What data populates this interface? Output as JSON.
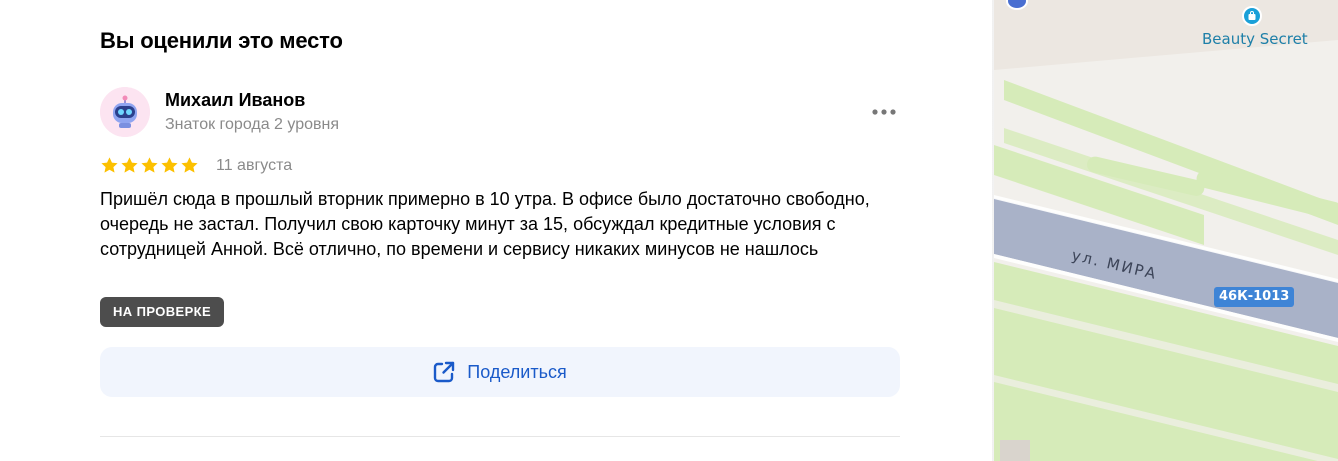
{
  "review_section": {
    "title": "Вы оценили это место"
  },
  "author": {
    "name": "Михаил Иванов",
    "level": "Знаток города 2 уровня",
    "avatar_icon": "robot-avatar-icon"
  },
  "review": {
    "rating": 5,
    "max_rating": 5,
    "date": "11 августа",
    "text": "Пришёл сюда в прошлый вторник примерно в 10 утра. В офисе было достаточно свободно, очередь не застал. Получил свою карточку минут за 15, обсуждал кредитные условия с сотрудницей Анной. Всё отлично, по времени и сервису никаких минусов не нашлось",
    "status": "НА ПРОВЕРКЕ"
  },
  "actions": {
    "share_label": "Поделиться",
    "more_icon": "more-dots-icon",
    "share_icon": "external-share-icon"
  },
  "map": {
    "poi_name": "Beauty Secret",
    "street_name": "ул. МИРА",
    "route_number": "46К-1013"
  },
  "colors": {
    "star": "#fcc000",
    "accent": "#1a5ac9",
    "badge_bg": "#4d4d4d",
    "share_bg": "#f1f5fd",
    "road": "#a9b2c8",
    "green": "#d6ebb9"
  }
}
